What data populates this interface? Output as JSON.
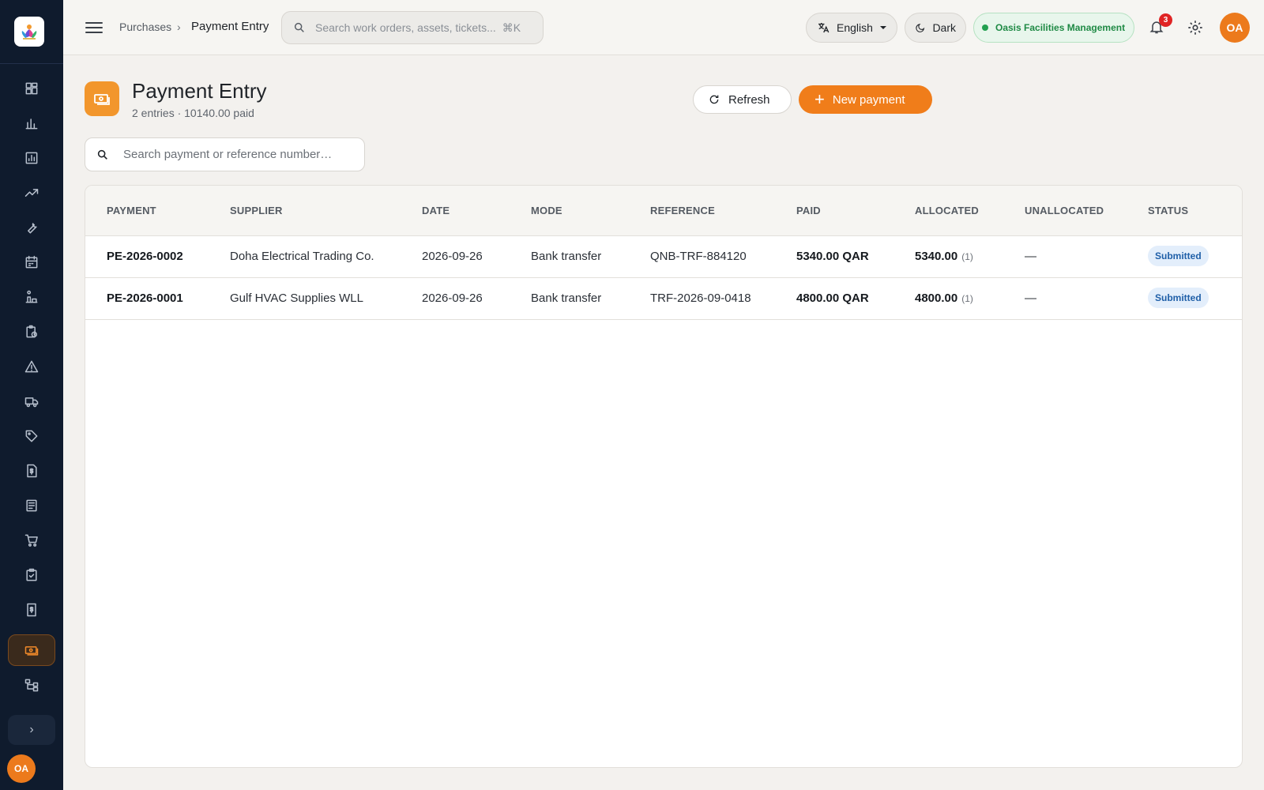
{
  "sidebar": {
    "items": [
      {
        "icon": "dashboard-icon"
      },
      {
        "icon": "bar-chart-icon"
      },
      {
        "icon": "report-icon"
      },
      {
        "icon": "trend-icon"
      },
      {
        "icon": "wrench-icon"
      },
      {
        "icon": "calendar-icon"
      },
      {
        "icon": "assets-icon"
      },
      {
        "icon": "clipboard-clock-icon"
      },
      {
        "icon": "warning-icon"
      },
      {
        "icon": "truck-icon"
      },
      {
        "icon": "tag-icon"
      },
      {
        "icon": "invoice-dollar-icon"
      },
      {
        "icon": "ledger-icon"
      },
      {
        "icon": "cart-icon"
      },
      {
        "icon": "clipboard-check-icon"
      },
      {
        "icon": "receipt-dollar-icon"
      },
      {
        "icon": "payment-icon"
      },
      {
        "icon": "hierarchy-icon"
      }
    ],
    "active_icon": "payment-icon",
    "expand_glyph": "›",
    "avatar_initials": "OA"
  },
  "topbar": {
    "breadcrumb_parent": "Purchases",
    "breadcrumb_sep": "›",
    "breadcrumb_current": "Payment Entry",
    "search_placeholder": "Search work orders, assets, tickets...",
    "search_shortcut": "⌘K",
    "language": "English",
    "theme_label": "Dark",
    "org_name": "Oasis Facilities Management",
    "notification_count": "3",
    "avatar_initials": "OA"
  },
  "page": {
    "title": "Payment Entry",
    "subtitle": "2 entries · 10140.00 paid",
    "refresh_label": "Refresh",
    "new_label": "New payment",
    "filter_placeholder": "Search payment or reference number…"
  },
  "table": {
    "columns": [
      "PAYMENT",
      "SUPPLIER",
      "DATE",
      "MODE",
      "REFERENCE",
      "PAID",
      "ALLOCATED",
      "UNALLOCATED",
      "STATUS"
    ],
    "rows": [
      {
        "payment": "PE-2026-0002",
        "supplier": "Doha Electrical Trading Co.",
        "date": "2026-09-26",
        "mode": "Bank transfer",
        "reference": "QNB-TRF-884120",
        "paid": "5340.00 QAR",
        "allocated": "5340.00",
        "allocated_count": "(1)",
        "unallocated": "—",
        "status": "Submitted"
      },
      {
        "payment": "PE-2026-0001",
        "supplier": "Gulf HVAC Supplies WLL",
        "date": "2026-09-26",
        "mode": "Bank transfer",
        "reference": "TRF-2026-09-0418",
        "paid": "4800.00 QAR",
        "allocated": "4800.00",
        "allocated_count": "(1)",
        "unallocated": "—",
        "status": "Submitted"
      }
    ]
  },
  "colors": {
    "accent": "#f07d1a",
    "sidebar_bg": "#0f1b2d",
    "status_badge_bg": "#e3eefb",
    "status_badge_text": "#1f5fa8",
    "org_pill_text": "#1f8a45"
  }
}
